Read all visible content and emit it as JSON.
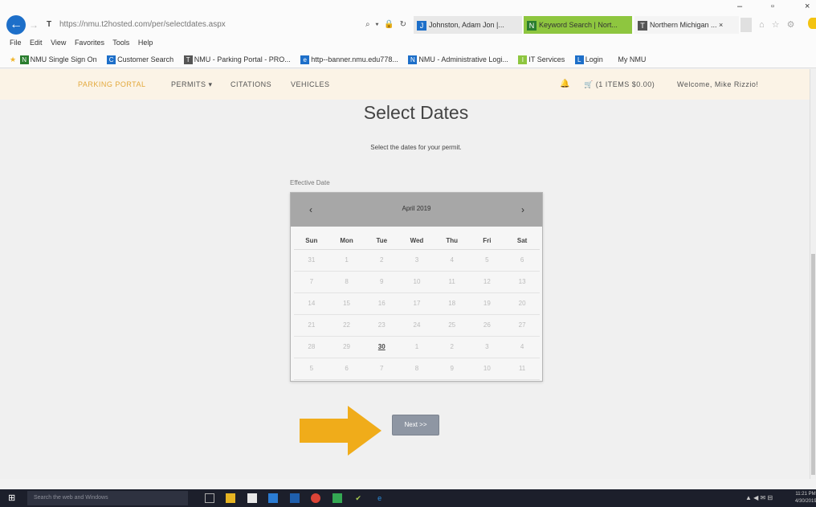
{
  "browser": {
    "address": "https://nmu.t2hosted.com/per/selectdates.aspx",
    "address_tools": "⌕ ▾ 🔒 ↻",
    "tabs": [
      {
        "label": "Johnston, Adam Jon |...",
        "icon": "J",
        "color": "#1d6fc9"
      },
      {
        "label": "Keyword Search | Nort...",
        "icon": "N",
        "color": "#2a7d2e"
      },
      {
        "label": "Northern Michigan ... ×",
        "icon": "T",
        "color": "#555555"
      }
    ],
    "right_icons": "⌂ ☆ ⚙",
    "window_controls": {
      "minimize": "–",
      "maximize": "▫",
      "close": "×"
    },
    "menu": [
      "File",
      "Edit",
      "View",
      "Favorites",
      "Tools",
      "Help"
    ],
    "favorites": [
      {
        "label": "NMU Single Sign On",
        "icon": "N",
        "color": "#2a7d2e"
      },
      {
        "label": "Customer Search",
        "icon": "C",
        "color": "#1d6fc9"
      },
      {
        "label": "NMU - Parking Portal - PRO...",
        "icon": "T",
        "color": "#555555"
      },
      {
        "label": "http--banner.nmu.edu778...",
        "icon": "e",
        "color": "#1d6fc9"
      },
      {
        "label": "NMU - Administrative Logi...",
        "icon": "N",
        "color": "#1d6fc9"
      },
      {
        "label": "IT Services",
        "icon": "I",
        "color": "#8ec63f"
      },
      {
        "label": "Login",
        "icon": "L",
        "color": "#1d6fc9"
      },
      {
        "label": "My NMU",
        "icon": "",
        "color": "#ffffff"
      }
    ]
  },
  "nav": {
    "brand": "PARKING PORTAL",
    "permits": "PERMITS ▾",
    "citations": "CITATIONS",
    "vehicles": "VEHICLES",
    "bell": "🔔",
    "cart": "🛒 (1 ITEMS $0.00)",
    "welcome": "Welcome, Mike Rizzio!"
  },
  "page": {
    "title": "Select Dates",
    "subtitle": "Select the dates for your permit.",
    "effective_label": "Effective Date"
  },
  "calendar": {
    "prev": "‹",
    "next": "›",
    "month": "April 2019",
    "weekdays": [
      "Sun",
      "Mon",
      "Tue",
      "Wed",
      "Thu",
      "Fri",
      "Sat"
    ],
    "weeks": [
      [
        "31",
        "1",
        "2",
        "3",
        "4",
        "5",
        "6"
      ],
      [
        "7",
        "8",
        "9",
        "10",
        "11",
        "12",
        "13"
      ],
      [
        "14",
        "15",
        "16",
        "17",
        "18",
        "19",
        "20"
      ],
      [
        "21",
        "22",
        "23",
        "24",
        "25",
        "26",
        "27"
      ],
      [
        "28",
        "29",
        "30",
        "1",
        "2",
        "3",
        "4"
      ],
      [
        "5",
        "6",
        "7",
        "8",
        "9",
        "10",
        "11"
      ]
    ],
    "current_day": "30"
  },
  "next_button": "Next >>",
  "arrow_color": "#f0ac1a",
  "taskbar": {
    "start": "⊞",
    "search_placeholder": "Search the web and Windows",
    "tray": "▲ ◀ ✉ ⊟",
    "clock_time": "11:21 PM",
    "clock_date": "4/30/2019"
  }
}
